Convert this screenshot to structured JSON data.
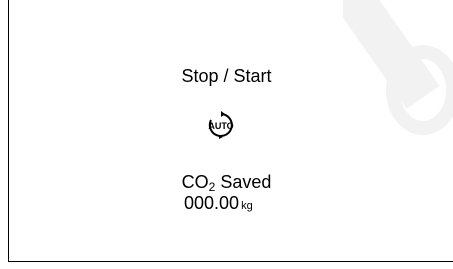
{
  "screen": {
    "title": "Stop / Start",
    "icon": "auto-stop-start-icon",
    "icon_text": "AUTO",
    "co2_label_main": "CO",
    "co2_label_sub": "2",
    "co2_label_tail": " Saved",
    "co2_value": "000.00",
    "co2_unit": "kg"
  },
  "colors": {
    "background": "#ffffff",
    "text": "#000000",
    "watermark": "#f2f2f2"
  }
}
